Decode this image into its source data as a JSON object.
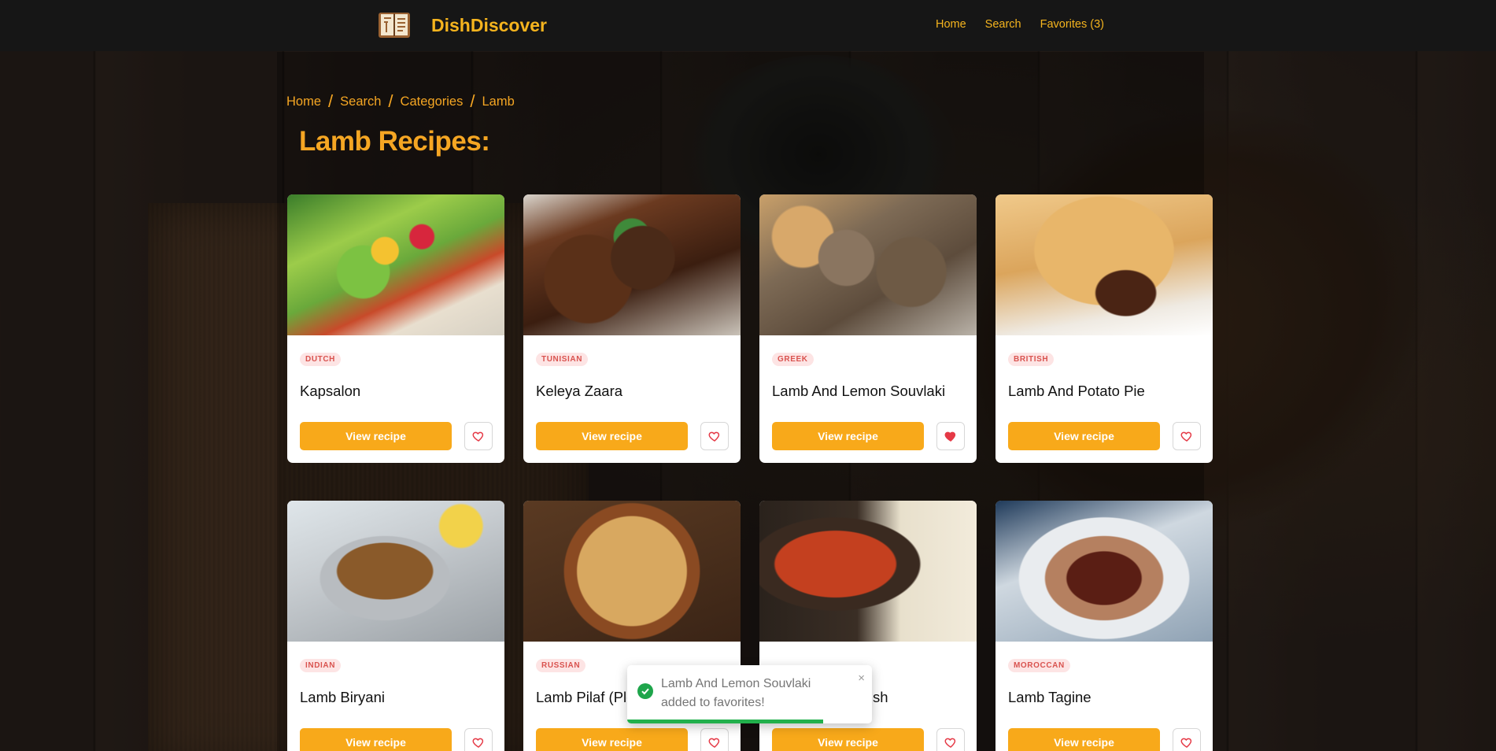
{
  "navbar": {
    "brand": "DishDiscover",
    "links": [
      "Home",
      "Search",
      "Favorites (3)"
    ]
  },
  "breadcrumb": [
    "Home",
    "Search",
    "Categories",
    "Lamb"
  ],
  "page_title": "Lamb Recipes:",
  "recipes": [
    {
      "cuisine": "DUTCH",
      "name": "Kapsalon",
      "button": "View recipe",
      "favorited": false,
      "icon": "heart-outline-icon"
    },
    {
      "cuisine": "TUNISIAN",
      "name": "Keleya Zaara",
      "button": "View recipe",
      "favorited": false,
      "icon": "heart-outline-icon"
    },
    {
      "cuisine": "GREEK",
      "name": "Lamb And Lemon Souvlaki",
      "button": "View recipe",
      "favorited": true,
      "icon": "heart-filled-icon"
    },
    {
      "cuisine": "BRITISH",
      "name": "Lamb And Potato Pie",
      "button": "View recipe",
      "favorited": false,
      "icon": "heart-outline-icon"
    },
    {
      "cuisine": "INDIAN",
      "name": "Lamb Biryani",
      "button": "View recipe",
      "favorited": false,
      "icon": "heart-outline-icon"
    },
    {
      "cuisine": "RUSSIAN",
      "name": "Lamb Pilaf (Plo",
      "button": "View recipe",
      "favorited": false,
      "icon": "heart-outline-icon"
    },
    {
      "cuisine": "",
      "name": "sh",
      "button": "View recipe",
      "favorited": false,
      "icon": "heart-outline-icon"
    },
    {
      "cuisine": "MOROCCAN",
      "name": "Lamb Tagine",
      "button": "View recipe",
      "favorited": false,
      "icon": "heart-outline-icon"
    }
  ],
  "toast": {
    "message": "Lamb And Lemon Souvlaki added to favorites!",
    "close": "×",
    "progress": 0.8,
    "icon": "check-circle-icon"
  },
  "colors": {
    "accent": "#f5b41e",
    "button": "#f8a91a",
    "heart": "#e53946",
    "badge_bg": "#fde4e4",
    "badge_text": "#d9534f",
    "toast_success": "#22b04c"
  }
}
